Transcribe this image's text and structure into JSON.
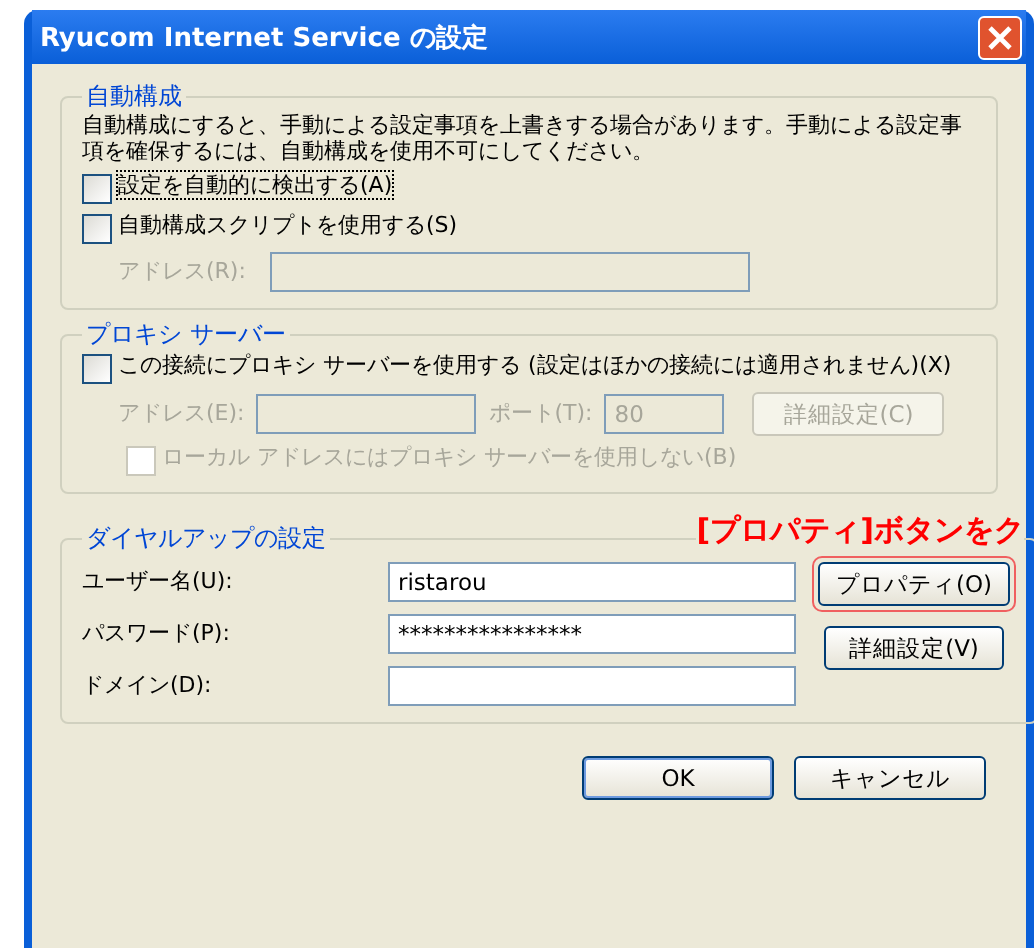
{
  "window": {
    "title": "Ryucom Internet Service の設定"
  },
  "auto_config": {
    "title": "自動構成",
    "description": "自動構成にすると、手動による設定事項を上書きする場合があります。手動による設定事項を確保するには、自動構成を使用不可にしてください。",
    "checkboxes": [
      {
        "label": "設定を自動的に検出する(A)",
        "checked": false,
        "focused": true
      },
      {
        "label": "自動構成スクリプトを使用する(S)",
        "checked": false,
        "focused": false
      }
    ],
    "address": {
      "label": "アドレス(R):",
      "disabled": true
    }
  },
  "proxy": {
    "title": "プロキシ サーバー",
    "checkbox": {
      "label": "この接続にプロキシ サーバーを使用する (設定はほかの接続には適用されません)(X)",
      "checked": false
    },
    "address": {
      "label": "アドレス(E):",
      "disabled": true
    },
    "port": {
      "label": "ポート(T):",
      "value": "80",
      "disabled": true
    },
    "advanced_button": {
      "label": "詳細設定(C)",
      "disabled": true
    },
    "bypass": {
      "label": "ローカル アドレスにはプロキシ サーバーを使用しない(B)",
      "checked": false,
      "disabled": true
    }
  },
  "annotation": {
    "text": "[プロパティ]ボタンをク"
  },
  "dialup": {
    "title": "ダイヤルアップの設定",
    "fields": [
      {
        "label": "ユーザー名(U):",
        "value": "ristarou"
      },
      {
        "label": "パスワード(P):",
        "value": "****************"
      },
      {
        "label": "ドメイン(D):"
      }
    ],
    "buttons": [
      {
        "label": "プロパティ(O)",
        "highlighted": true
      },
      {
        "label": "詳細設定(V)",
        "highlighted": false
      }
    ]
  },
  "buttons": [
    {
      "label": "OK",
      "default": true
    },
    {
      "label": "キャンセル",
      "default": false
    }
  ]
}
